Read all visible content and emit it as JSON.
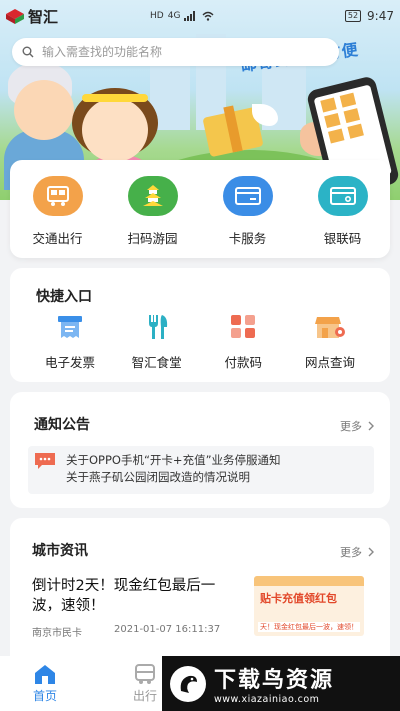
{
  "status_bar": {
    "app_name": "智汇",
    "network_badge_1": "HD",
    "network_badge_2": "4G",
    "battery": "52",
    "time": "9:47"
  },
  "banner": {
    "slogan": "邮寄到家真方便"
  },
  "search": {
    "placeholder": "输入需查找的功能名称"
  },
  "services": [
    {
      "label": "交通出行",
      "icon": "bus-card-icon",
      "color": "#f3a24a"
    },
    {
      "label": "扫码游园",
      "icon": "pagoda-icon",
      "color": "#46b04a"
    },
    {
      "label": "卡服务",
      "icon": "card-icon",
      "color": "#3b8de6"
    },
    {
      "label": "银联码",
      "icon": "unionpay-card-icon",
      "color": "#2bb3c6"
    }
  ],
  "quick_access": {
    "title": "快捷入口",
    "items": [
      {
        "label": "电子发票",
        "icon": "invoice-icon",
        "color": "#3a8fe8"
      },
      {
        "label": "智汇食堂",
        "icon": "cutlery-icon",
        "color": "#2cb0c4"
      },
      {
        "label": "付款码",
        "icon": "payment-code-icon",
        "color": "#ee6b51"
      },
      {
        "label": "网点查询",
        "icon": "store-location-icon",
        "color": "#f3a24a"
      }
    ]
  },
  "notice": {
    "title": "通知公告",
    "more": "更多",
    "lines": [
      "关于OPPO手机“开卡+充值”业务停服通知",
      "关于燕子矶公园闭园改造的情况说明"
    ]
  },
  "news": {
    "title": "城市资讯",
    "more": "更多",
    "headline": "倒计时2天！现金红包最后一波，速领！",
    "source": "南京市民卡",
    "date": "2021-01-07 16:11:37",
    "thumb_title": "贴卡充值领红包",
    "thumb_sub": "天！现金红包最后一波，速领！"
  },
  "bottom_nav": {
    "home": "首页",
    "travel": "出行"
  },
  "watermark": {
    "title": "下载鸟资源",
    "url": "www.xiazainiao.com"
  },
  "colors": {
    "accent": "#2e86e6"
  }
}
